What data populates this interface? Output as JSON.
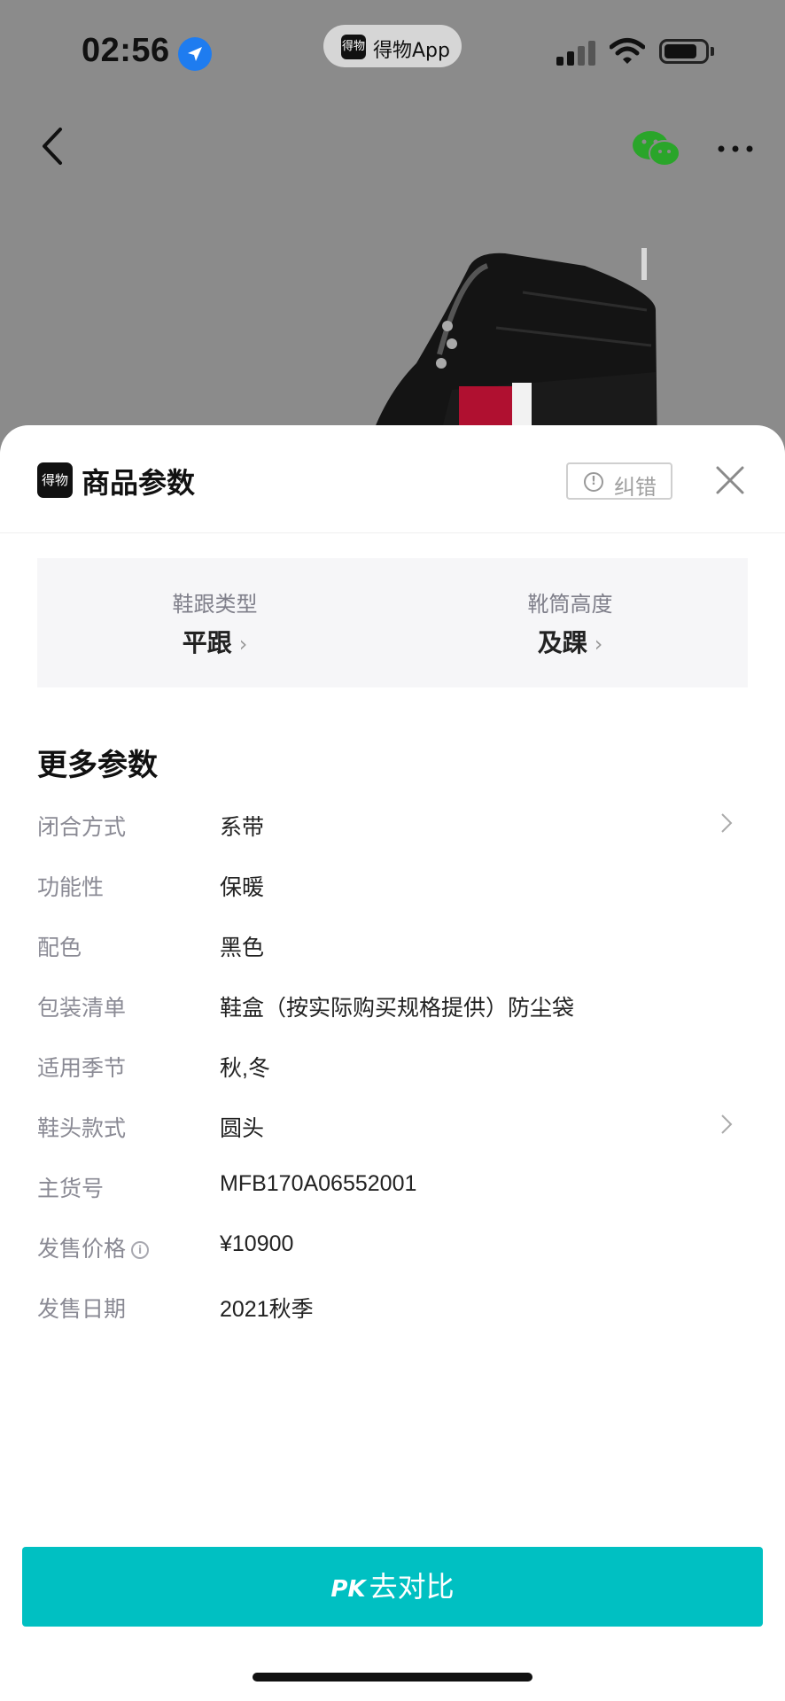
{
  "status_bar": {
    "time": "02:56",
    "app_name": "得物App",
    "app_logo_text": "得物"
  },
  "nav": {
    "back_icon": "chevron-left-icon",
    "share_icon": "wechat-icon",
    "more_icon": "more-horizontal-icon"
  },
  "sheet": {
    "logo_text": "得物",
    "title": "商品参数",
    "report_button": "纠错",
    "close_icon": "close-icon"
  },
  "summary": [
    {
      "label": "鞋跟类型",
      "value": "平跟"
    },
    {
      "label": "靴筒高度",
      "value": "及踝"
    }
  ],
  "more_params_title": "更多参数",
  "params": [
    {
      "label": "闭合方式",
      "value": "系带",
      "has_link": true
    },
    {
      "label": "功能性",
      "value": "保暖",
      "has_link": false
    },
    {
      "label": "配色",
      "value": "黑色",
      "has_link": false
    },
    {
      "label": "包装清单",
      "value": "鞋盒（按实际购买规格提供）防尘袋",
      "has_link": false
    },
    {
      "label": "适用季节",
      "value": "秋,冬",
      "has_link": false
    },
    {
      "label": "鞋头款式",
      "value": "圆头",
      "has_link": true
    },
    {
      "label": "主货号",
      "value": "MFB170A06552001",
      "has_link": false
    },
    {
      "label": "发售价格",
      "value": "¥10900",
      "has_link": false,
      "info": true
    },
    {
      "label": "发售日期",
      "value": "2021秋季",
      "has_link": false
    }
  ],
  "compare_button": {
    "prefix": "PK",
    "label": "去对比"
  },
  "colors": {
    "accent": "#00c0c2"
  }
}
